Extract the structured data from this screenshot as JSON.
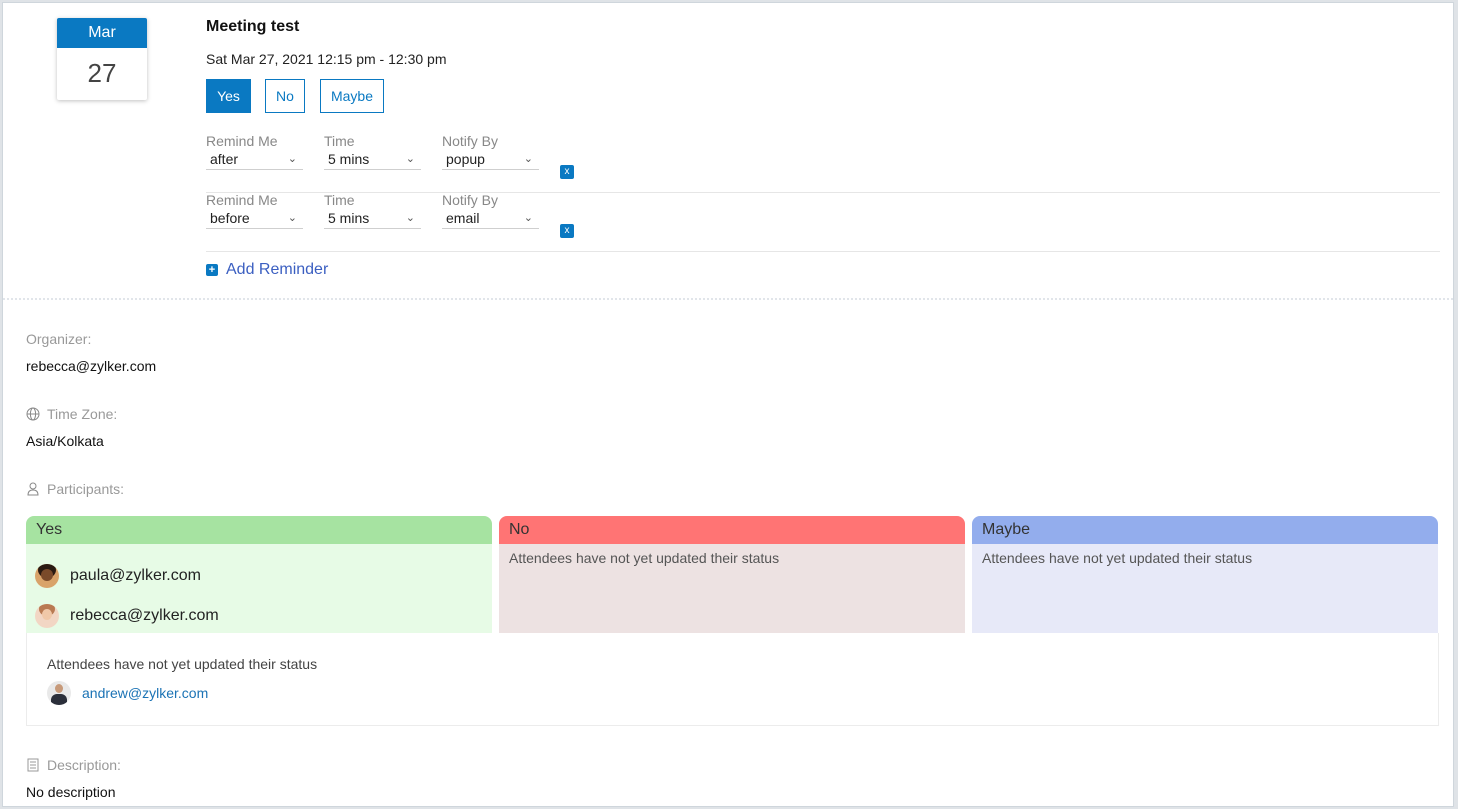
{
  "event": {
    "month": "Mar",
    "day": "27",
    "title": "Meeting test",
    "datetime": "Sat Mar 27, 2021 12:15 pm - 12:30 pm"
  },
  "rsvp": {
    "yes": "Yes",
    "no": "No",
    "maybe": "Maybe",
    "selected": "Yes"
  },
  "reminders": [
    {
      "remind_label": "Remind Me",
      "remind_value": "after",
      "time_label": "Time",
      "time_value": "5 mins",
      "notify_label": "Notify By",
      "notify_value": "popup",
      "remove": "x"
    },
    {
      "remind_label": "Remind Me",
      "remind_value": "before",
      "time_label": "Time",
      "time_value": "5 mins",
      "notify_label": "Notify By",
      "notify_value": "email",
      "remove": "x"
    }
  ],
  "add_reminder": "Add Reminder",
  "organizer": {
    "label": "Organizer:",
    "value": "rebecca@zylker.com"
  },
  "timezone": {
    "label": "Time Zone:",
    "value": "Asia/Kolkata",
    "icon": "globe-icon"
  },
  "participants": {
    "label": "Participants:",
    "icon": "person-icon",
    "columns": [
      {
        "title": "Yes",
        "head_color": "#a6e3a1",
        "body_color": "#e7fbe6",
        "people": [
          "paula@zylker.com",
          "rebecca@zylker.com"
        ]
      },
      {
        "title": "No",
        "head_color": "#ff7474",
        "body_color": "#ede2e2",
        "note": "Attendees have not yet updated their status"
      },
      {
        "title": "Maybe",
        "head_color": "#93aded",
        "body_color": "#e7e9f8",
        "note": "Attendees have not yet updated their status"
      }
    ],
    "pending_note": "Attendees have not yet updated their status",
    "pending_people": [
      "andrew@zylker.com"
    ]
  },
  "description": {
    "label": "Description:",
    "value": "No description",
    "icon": "document-icon"
  }
}
